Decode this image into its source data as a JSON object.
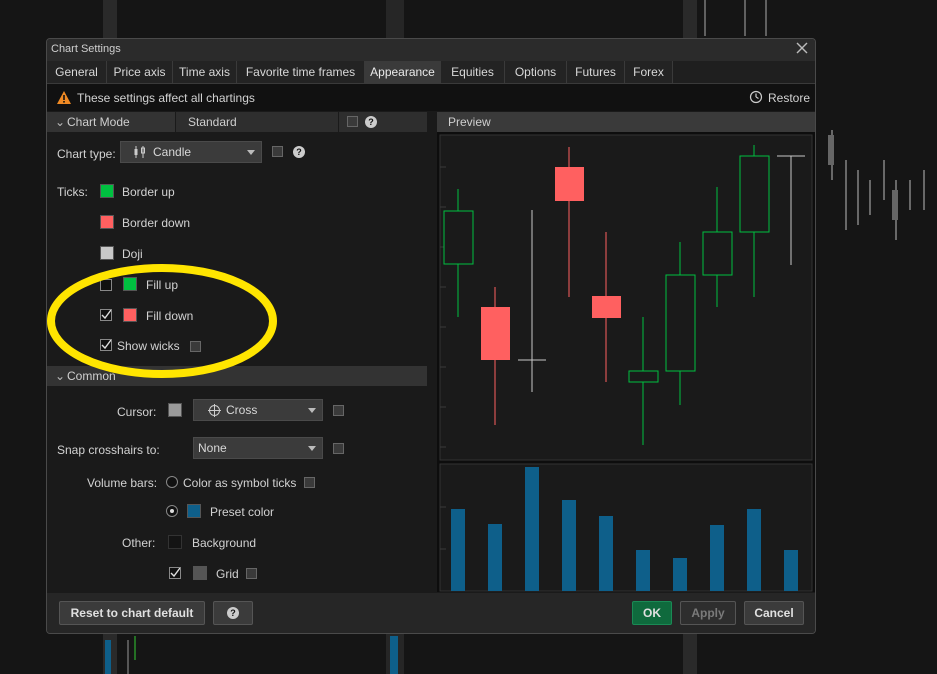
{
  "dialog": {
    "title": "Chart Settings"
  },
  "tabs": [
    {
      "label": "General"
    },
    {
      "label": "Price axis"
    },
    {
      "label": "Time axis"
    },
    {
      "label": "Favorite time frames"
    },
    {
      "label": "Appearance"
    },
    {
      "label": "Equities"
    },
    {
      "label": "Options"
    },
    {
      "label": "Futures"
    },
    {
      "label": "Forex"
    }
  ],
  "active_tab": "Appearance",
  "warning": {
    "text": "These settings affect all chartings",
    "restore_label": "Restore"
  },
  "chart_mode": {
    "header": "Chart Mode",
    "value": "Standard"
  },
  "chart_type": {
    "label": "Chart type:",
    "value": "Candle"
  },
  "ticks": {
    "label": "Ticks:",
    "border_up": "Border up",
    "border_down": "Border down",
    "doji": "Doji",
    "fill_up": "Fill up",
    "fill_down": "Fill down",
    "show_wicks": "Show wicks",
    "fill_up_checked": false,
    "fill_down_checked": true,
    "show_wicks_checked": true
  },
  "colors": {
    "up": "#00c040",
    "down": "#ff6060",
    "doji": "#c8c8c8",
    "volume": "#0e5f8a",
    "preset": "#0e5f8a",
    "highlight": "#ffe500",
    "ok_bg": "#0f6a3d"
  },
  "common": {
    "header": "Common",
    "cursor_label": "Cursor:",
    "cursor_value": "Cross",
    "snap_label": "Snap crosshairs to:",
    "snap_value": "None",
    "volume_label": "Volume bars:",
    "volume_opt1": "Color as symbol ticks",
    "volume_opt2": "Preset color",
    "other_label": "Other:",
    "background": "Background",
    "grid": "Grid",
    "grid_checked": true
  },
  "preview": {
    "header": "Preview"
  },
  "footer": {
    "reset": "Reset to chart default",
    "help": "?",
    "ok": "OK",
    "apply": "Apply",
    "cancel": "Cancel"
  }
}
